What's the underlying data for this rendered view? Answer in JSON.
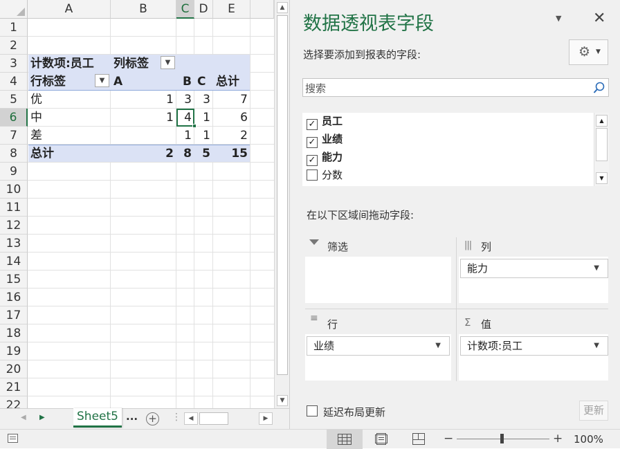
{
  "sheet": {
    "columns": [
      "A",
      "B",
      "C",
      "D",
      "E"
    ],
    "rows": [
      "1",
      "2",
      "3",
      "4",
      "5",
      "6",
      "7",
      "8",
      "9",
      "10",
      "11",
      "12",
      "13",
      "14",
      "15",
      "16",
      "17",
      "18",
      "19",
      "20",
      "21",
      "22"
    ],
    "pivot": {
      "count_label": "计数项:员工",
      "col_labels_label": "列标签",
      "row_labels_label": "行标签",
      "col_headers": [
        "A",
        "B",
        "C",
        "总计"
      ],
      "rows": [
        {
          "label": "优",
          "a": "1",
          "b": "3",
          "c": "3",
          "total": "7"
        },
        {
          "label": "中",
          "a": "1",
          "b": "4",
          "c": "1",
          "total": "6"
        },
        {
          "label": "差",
          "a": "",
          "b": "1",
          "c": "1",
          "total": "2"
        }
      ],
      "grand_total": {
        "label": "总计",
        "a": "2",
        "b": "8",
        "c": "5",
        "total": "15"
      }
    }
  },
  "tabs": {
    "active": "Sheet5",
    "more": "..."
  },
  "status": {
    "zoom": "100%"
  },
  "panel": {
    "title": "数据透视表字段",
    "choose_label": "选择要添加到报表的字段:",
    "search_placeholder": "搜索",
    "fields": [
      {
        "name": "员工",
        "checked": true
      },
      {
        "name": "业绩",
        "checked": true
      },
      {
        "name": "能力",
        "checked": true
      },
      {
        "name": "分数",
        "checked": false
      }
    ],
    "drag_label": "在以下区域间拖动字段:",
    "areas": {
      "filters": {
        "label": "筛选"
      },
      "columns": {
        "label": "列",
        "item": "能力"
      },
      "rows": {
        "label": "行",
        "item": "业绩"
      },
      "values": {
        "label": "值",
        "item": "计数项:员工"
      }
    },
    "defer_label": "延迟布局更新",
    "update_label": "更新"
  }
}
